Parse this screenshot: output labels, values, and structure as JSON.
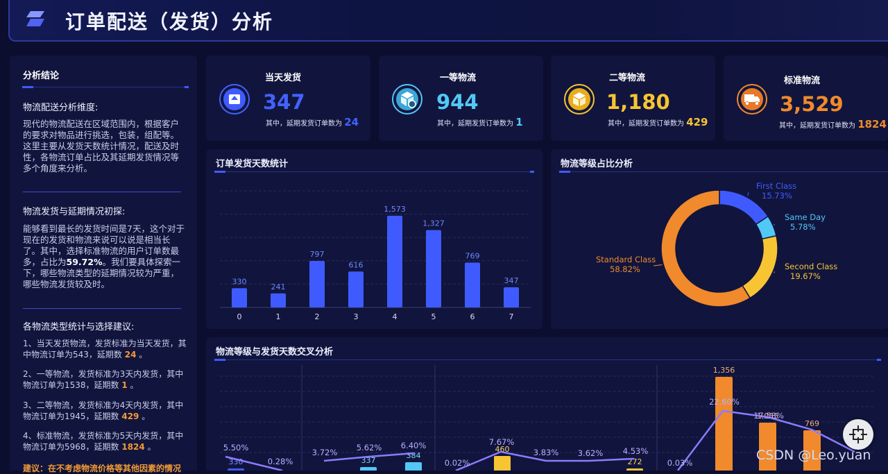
{
  "header": {
    "title": "订单配送（发货）分析"
  },
  "conclusion": {
    "title": "分析结论",
    "section1": {
      "head": "物流配送分析维度:",
      "body": "现代的物流配送在区域范围内，根据客户的要求对物品进行挑选，包装，组配等。这里主要从发货天数统计情况，配送及时性，各物流订单占比及其延期发货情况等多个角度来分析。"
    },
    "section2": {
      "head": "物流发货与延期情况初探:",
      "body_pre": "能够看到最长的发货时间是7天，这个对于现在的发货和物流来说可以说是相当长了。其中，选择标准物流的用户订单数最多，占比为",
      "body_pct": "59.72%",
      "body_post": "。我们要具体探索一下，哪些物流类型的延期情况较为严重，哪些物流发货较及时。"
    },
    "section3": {
      "head": "各物流类型统计与选择建议:",
      "items": [
        {
          "pre": "1、当天发货物流，发货标准为当天发货，其中物流订单为543，延期数 ",
          "num": "24",
          "post": " 。"
        },
        {
          "pre": "2、一等物流，发货标准为3天内发货，其中物流订单为1538，延期数 ",
          "num": "1",
          "post": " 。"
        },
        {
          "pre": "3、二等物流，发货标准为4天内发货，其中物流订单为1945，延期数 ",
          "num": "429",
          "post": " 。"
        },
        {
          "pre": "4、标准物流，发货标准为5天内发货，其中物流订单为5968，延期数 ",
          "num": "1824",
          "post": " 。"
        }
      ],
      "suggest": "建议：在不考虑物流价格等其他因素的情况"
    }
  },
  "kpis": [
    {
      "label": "当天发货",
      "value": "347",
      "sub": "其中，延期发货订单数为",
      "delay": "24",
      "color": "#4262ff",
      "icon": "inbox-upload-icon"
    },
    {
      "label": "一等物流",
      "value": "944",
      "sub": "其中，延期发货订单数为",
      "delay": "1",
      "color": "#52c8f5",
      "icon": "package-clock-icon"
    },
    {
      "label": "二等物流",
      "value": "1,180",
      "sub": "其中，延期发货订单数为",
      "delay": "429",
      "color": "#f7c433",
      "icon": "box-icon"
    },
    {
      "label": "标准物流",
      "value": "3,529",
      "sub": "其中，延期发货订单数为",
      "delay": "1824",
      "color": "#f08a2c",
      "icon": "truck-icon"
    }
  ],
  "bar_panel": {
    "title": "订单发货天数统计"
  },
  "pie_panel": {
    "title": "物流等级占比分析"
  },
  "cross_panel": {
    "title": "物流等级与发货天数交叉分析"
  },
  "watermark": "CSDN @Leo.yuan",
  "chart_data": [
    {
      "type": "bar",
      "categories": [
        "0",
        "1",
        "2",
        "3",
        "4",
        "5",
        "6",
        "7"
      ],
      "values": [
        330,
        241,
        797,
        616,
        1573,
        1327,
        769,
        347
      ],
      "data_labels": [
        "330",
        "241",
        "797",
        "616",
        "1,573",
        "1,327",
        "769",
        "347"
      ],
      "ylim": [
        0,
        2000
      ],
      "grid": true,
      "color": "#3f5bff"
    },
    {
      "type": "pie",
      "labels": [
        "First Class",
        "Same Day",
        "Second Class",
        "Standard Class"
      ],
      "values": [
        15.73,
        5.78,
        19.67,
        58.82
      ],
      "pct_labels": [
        "15.73%",
        "5.78%",
        "19.67%",
        "58.82%"
      ],
      "colors": [
        "#3f5bff",
        "#52c8f5",
        "#f7c433",
        "#f08a2c"
      ]
    },
    {
      "type": "bar",
      "visible_bar_labels": [
        "330",
        "337",
        "384",
        "460",
        "272",
        "1,356",
        "1,055",
        "769"
      ],
      "visible_line_labels": [
        "5.50%",
        "0.28%",
        "3.72%",
        "5.62%",
        "6.40%",
        "0.02%",
        "7.67%",
        "3.83%",
        "3.62%",
        "4.53%",
        "0.03%",
        "22.60%",
        "17.58%"
      ],
      "colors": {
        "same_day": "#3f5bff",
        "first_class": "#52c8f5",
        "second_class": "#f7c433",
        "standard": "#f08a2c",
        "line": "#8a7cff"
      }
    }
  ]
}
